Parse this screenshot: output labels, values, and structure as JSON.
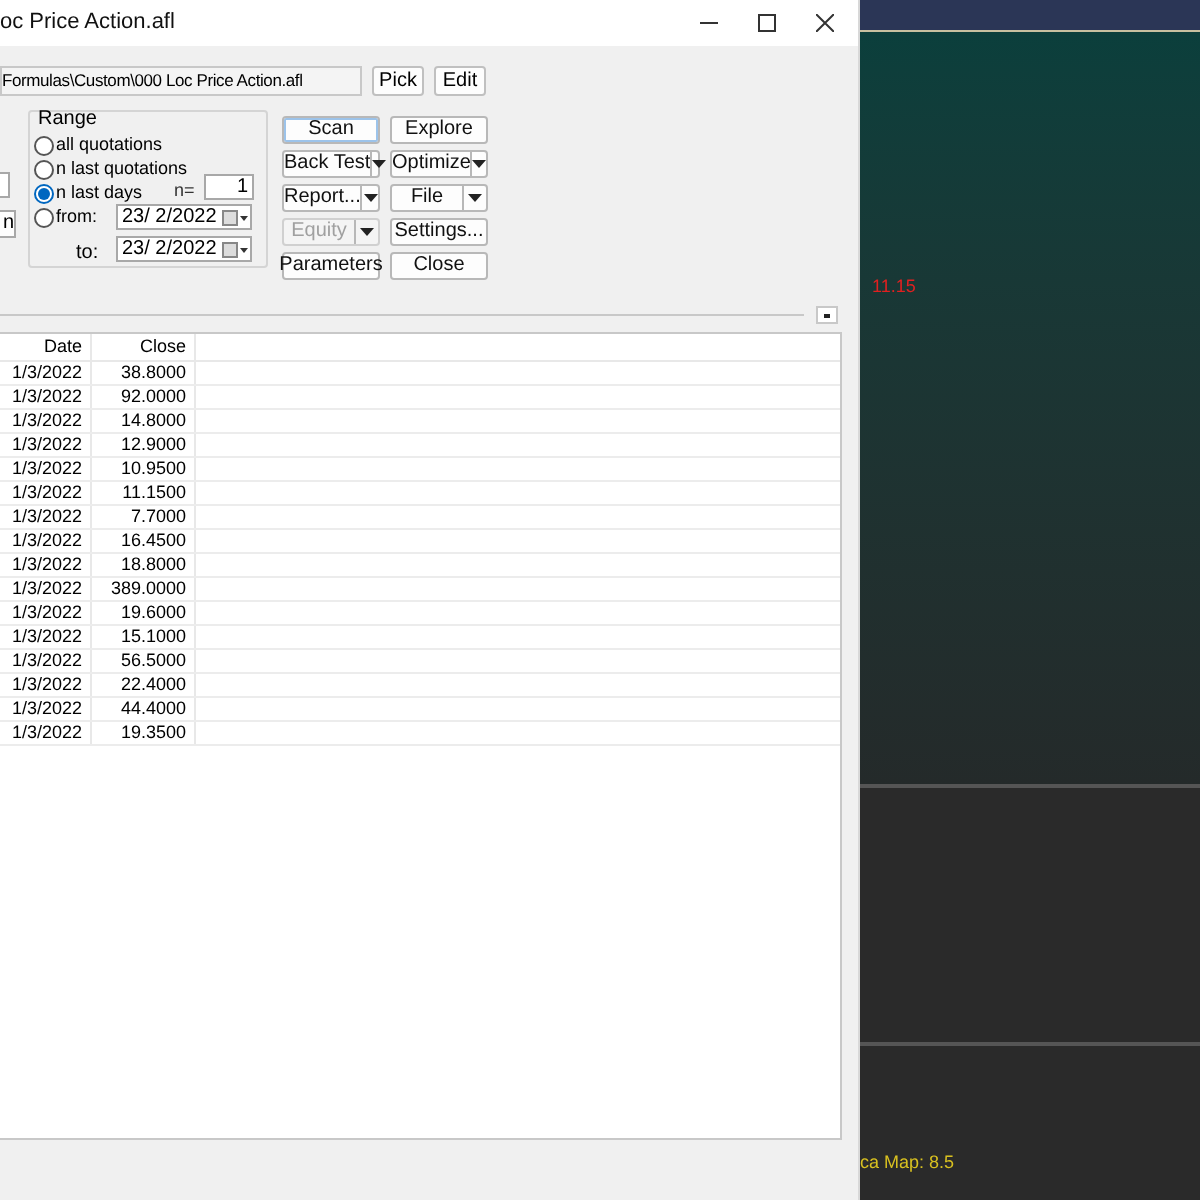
{
  "window": {
    "title": "oc Price Action.afl"
  },
  "formula": {
    "path": "Formulas\\Custom\\000 Loc Price Action.afl",
    "buttons": [
      "Pick",
      "Edit"
    ]
  },
  "left_cut": {
    "label": "n"
  },
  "range": {
    "title": "Range",
    "options": [
      {
        "label": "all quotations",
        "selected": false
      },
      {
        "label": "n last quotations",
        "selected": false
      },
      {
        "label": "n last days",
        "selected": true
      },
      {
        "label": "from:",
        "selected": false
      }
    ],
    "n_label": "n=",
    "n_value": "1",
    "from_value": "23/ 2/2022",
    "to_label": "to:",
    "to_value": "23/ 2/2022"
  },
  "actions": [
    {
      "label": "Scan",
      "kind": "plain",
      "focused": true,
      "disabled": false
    },
    {
      "label": "Explore",
      "kind": "plain",
      "focused": false,
      "disabled": false
    },
    {
      "label": "Back Test",
      "kind": "split",
      "focused": false,
      "disabled": false
    },
    {
      "label": "Optimize",
      "kind": "split",
      "focused": false,
      "disabled": false
    },
    {
      "label": "Report...",
      "kind": "split",
      "focused": false,
      "disabled": false
    },
    {
      "label": "File",
      "kind": "split",
      "focused": false,
      "disabled": false
    },
    {
      "label": "Equity",
      "kind": "split",
      "focused": false,
      "disabled": true
    },
    {
      "label": "Settings...",
      "kind": "plain",
      "focused": false,
      "disabled": false
    },
    {
      "label": "Parameters",
      "kind": "plain",
      "focused": false,
      "disabled": false
    },
    {
      "label": "Close",
      "kind": "plain",
      "focused": false,
      "disabled": false
    }
  ],
  "table": {
    "columns": [
      "Date",
      "Close"
    ],
    "rows": [
      [
        "1/3/2022",
        "38.8000"
      ],
      [
        "1/3/2022",
        "92.0000"
      ],
      [
        "1/3/2022",
        "14.8000"
      ],
      [
        "1/3/2022",
        "12.9000"
      ],
      [
        "1/3/2022",
        "10.9500"
      ],
      [
        "1/3/2022",
        "11.1500"
      ],
      [
        "1/3/2022",
        "7.7000"
      ],
      [
        "1/3/2022",
        "16.4500"
      ],
      [
        "1/3/2022",
        "18.8000"
      ],
      [
        "1/3/2022",
        "389.0000"
      ],
      [
        "1/3/2022",
        "19.6000"
      ],
      [
        "1/3/2022",
        "15.1000"
      ],
      [
        "1/3/2022",
        "56.5000"
      ],
      [
        "1/3/2022",
        "22.4000"
      ],
      [
        "1/3/2022",
        "44.4000"
      ],
      [
        "1/3/2022",
        "19.3500"
      ]
    ]
  },
  "chart": {
    "price_label": {
      "text": "11.15",
      "color": "#e02020"
    },
    "footer": "ca Map: 8.5"
  }
}
